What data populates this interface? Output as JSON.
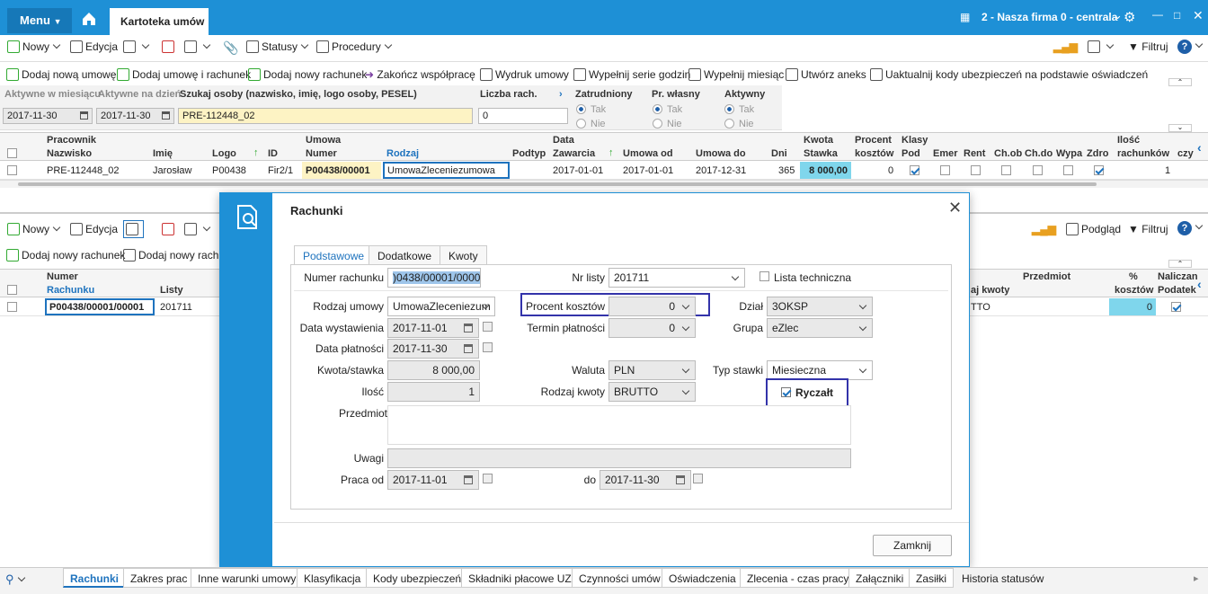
{
  "top": {
    "menu": "Menu",
    "tab": "Kartoteka umów",
    "company": "2 - Nasza firma 0 - centrala"
  },
  "tb1": {
    "new": "Nowy",
    "edit": "Edycja",
    "statuses": "Statusy",
    "procedures": "Procedury",
    "filter": "Filtruj"
  },
  "tb2": [
    "Dodaj nową umowę",
    "Dodaj umowę i rachunek",
    "Dodaj nowy rachunek",
    "Zakończ współpracę",
    "Wydruk umowy",
    "Wypełnij serie godzin",
    "Wypełnij miesiąc",
    "Utwórz aneks",
    "Uaktualnij kody ubezpieczeń na podstawie oświadczeń"
  ],
  "filter": {
    "active_month": "Aktywne w miesiącu",
    "active_day": "Aktywne na dzień",
    "search_label": "Szukaj osoby (nazwisko, imię, logo osoby, PESEL)",
    "count_label": "Liczba rach.",
    "employed": "Zatrudniony",
    "own": "Pr. własny",
    "active": "Aktywny",
    "date1": "2017-11-30",
    "date2": "2017-11-30",
    "search_value": "PRE-112448_02",
    "count_value": "0",
    "yes": "Tak",
    "no": "Nie"
  },
  "grid1": {
    "h_worker": "Pracownik",
    "h_contract": "Umowa",
    "h_date": "Data",
    "h_rate": "Kwota",
    "h_pct": "Procent",
    "h_classes": "Klasy",
    "h_count": "Ilość",
    "surname": "Nazwisko",
    "name": "Imię",
    "logo": "Logo",
    "id": "ID",
    "number": "Numer",
    "type": "Rodzaj",
    "subtype": "Podtyp",
    "concluded": "Zawarcia",
    "from": "Umowa od",
    "to": "Umowa do",
    "days": "Dni",
    "stawka": "Stawka",
    "costs": "kosztów",
    "pod": "Pod",
    "emer": "Emer",
    "rent": "Rent",
    "chob": "Ch.ob",
    "chdo": "Ch.do",
    "wypa": "Wypa",
    "zdro": "Zdro",
    "bills": "rachunków",
    "czy": "czy",
    "row": {
      "surname": "PRE-112448_02",
      "name": "Jarosław",
      "logo": "P00438",
      "id": "Fir2/1",
      "number": "P00438/00001",
      "type": "UmowaZleceniezumowa",
      "concluded": "2017-01-01",
      "from": "2017-01-01",
      "to": "2017-12-31",
      "days": "365",
      "rate": "8 000,00",
      "pct": "0",
      "bills": "1"
    }
  },
  "tb3": {
    "new": "Nowy",
    "edit": "Edycja",
    "preview": "Podgląd",
    "filter": "Filtruj",
    "add_bill": "Dodaj nowy rachunek",
    "add_bill2": "Dodaj nowy rachun"
  },
  "grid2": {
    "h_number": "Numer",
    "bill": "Rachunku",
    "lists": "Listy",
    "subject": "Przedmiot",
    "kwoty": "aj kwoty",
    "pct": "%",
    "costs": "kosztów",
    "nalicz": "Naliczan",
    "podatek": "Podatek",
    "row": {
      "bill": "P00438/00001/00001",
      "list": "201711",
      "tto": "TTO",
      "pct": "0"
    }
  },
  "modal": {
    "title": "Rachunki",
    "tabs": [
      "Podstawowe",
      "Dodatkowe",
      "Kwoty"
    ],
    "l_number": "Numer rachunku",
    "v_number": ")0438/00001/00001",
    "l_nrlist": "Nr listy",
    "v_nrlist": "201711",
    "l_tech": "Lista techniczna",
    "l_kind": "Rodzaj umowy",
    "v_kind": "UmowaZleceniezum",
    "l_pct": "Procent kosztów",
    "v_pct": "0",
    "l_dept": "Dział",
    "v_dept": "3OKSP",
    "l_issue": "Data wystawienia",
    "v_issue": "2017-11-01",
    "l_term": "Termin płatności",
    "v_term": "0",
    "l_group": "Grupa",
    "v_group": "eZlec",
    "l_pay": "Data płatności",
    "v_pay": "2017-11-30",
    "l_amount": "Kwota/stawka",
    "v_amount": "8 000,00",
    "l_currency": "Waluta",
    "v_currency": "PLN",
    "l_ratetype": "Typ stawki",
    "v_ratetype": "Miesieczna",
    "l_qty": "Ilość",
    "v_qty": "1",
    "l_amtkind": "Rodzaj kwoty",
    "v_amtkind": "BRUTTO",
    "l_lump": "Ryczałt",
    "l_subject": "Przedmiot",
    "l_notes": "Uwagi",
    "l_workfrom": "Praca od",
    "v_workfrom": "2017-11-01",
    "l_to": "do",
    "v_workto": "2017-11-30",
    "close": "Zamknij"
  },
  "bottom_tabs": [
    "Rachunki",
    "Zakres prac",
    "Inne warunki umowy",
    "Klasyfikacja",
    "Kody ubezpieczeń",
    "Składniki płacowe UZ",
    "Czynności umów",
    "Oświadczenia",
    "Zlecenia - czas pracy",
    "Załączniki",
    "Zasiłki",
    "Historia statusów"
  ]
}
